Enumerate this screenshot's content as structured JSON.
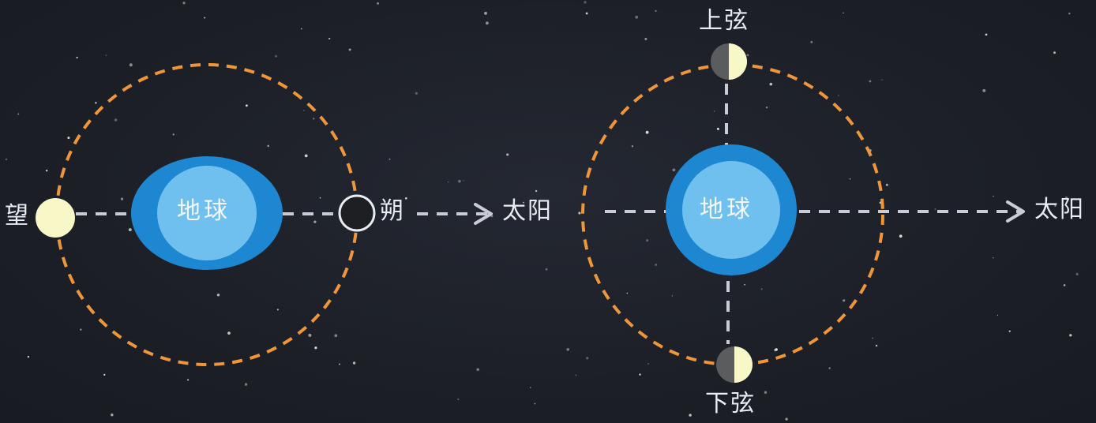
{
  "colors": {
    "background": "#1c1f26",
    "orbit": "#f0963a",
    "earth_outer": "#1e87d2",
    "earth_inner": "#6fc0ef",
    "moon_full": "#f8f7c8",
    "moon_new": "#1e1f22",
    "moon_dark_half": "#5a5c5e",
    "connector": "#c9ccd6"
  },
  "left_diagram": {
    "earth_label": "地球",
    "full_moon_label": "望",
    "new_moon_label": "朔",
    "sun_label": "太阳"
  },
  "right_diagram": {
    "earth_label": "地球",
    "first_quarter_label": "上弦",
    "last_quarter_label": "下弦",
    "sun_label": "太阳"
  },
  "icons": [
    "full-moon-icon",
    "new-moon-icon",
    "first-quarter-moon-icon",
    "last-quarter-moon-icon",
    "earth-icon",
    "arrow-right-icon"
  ]
}
